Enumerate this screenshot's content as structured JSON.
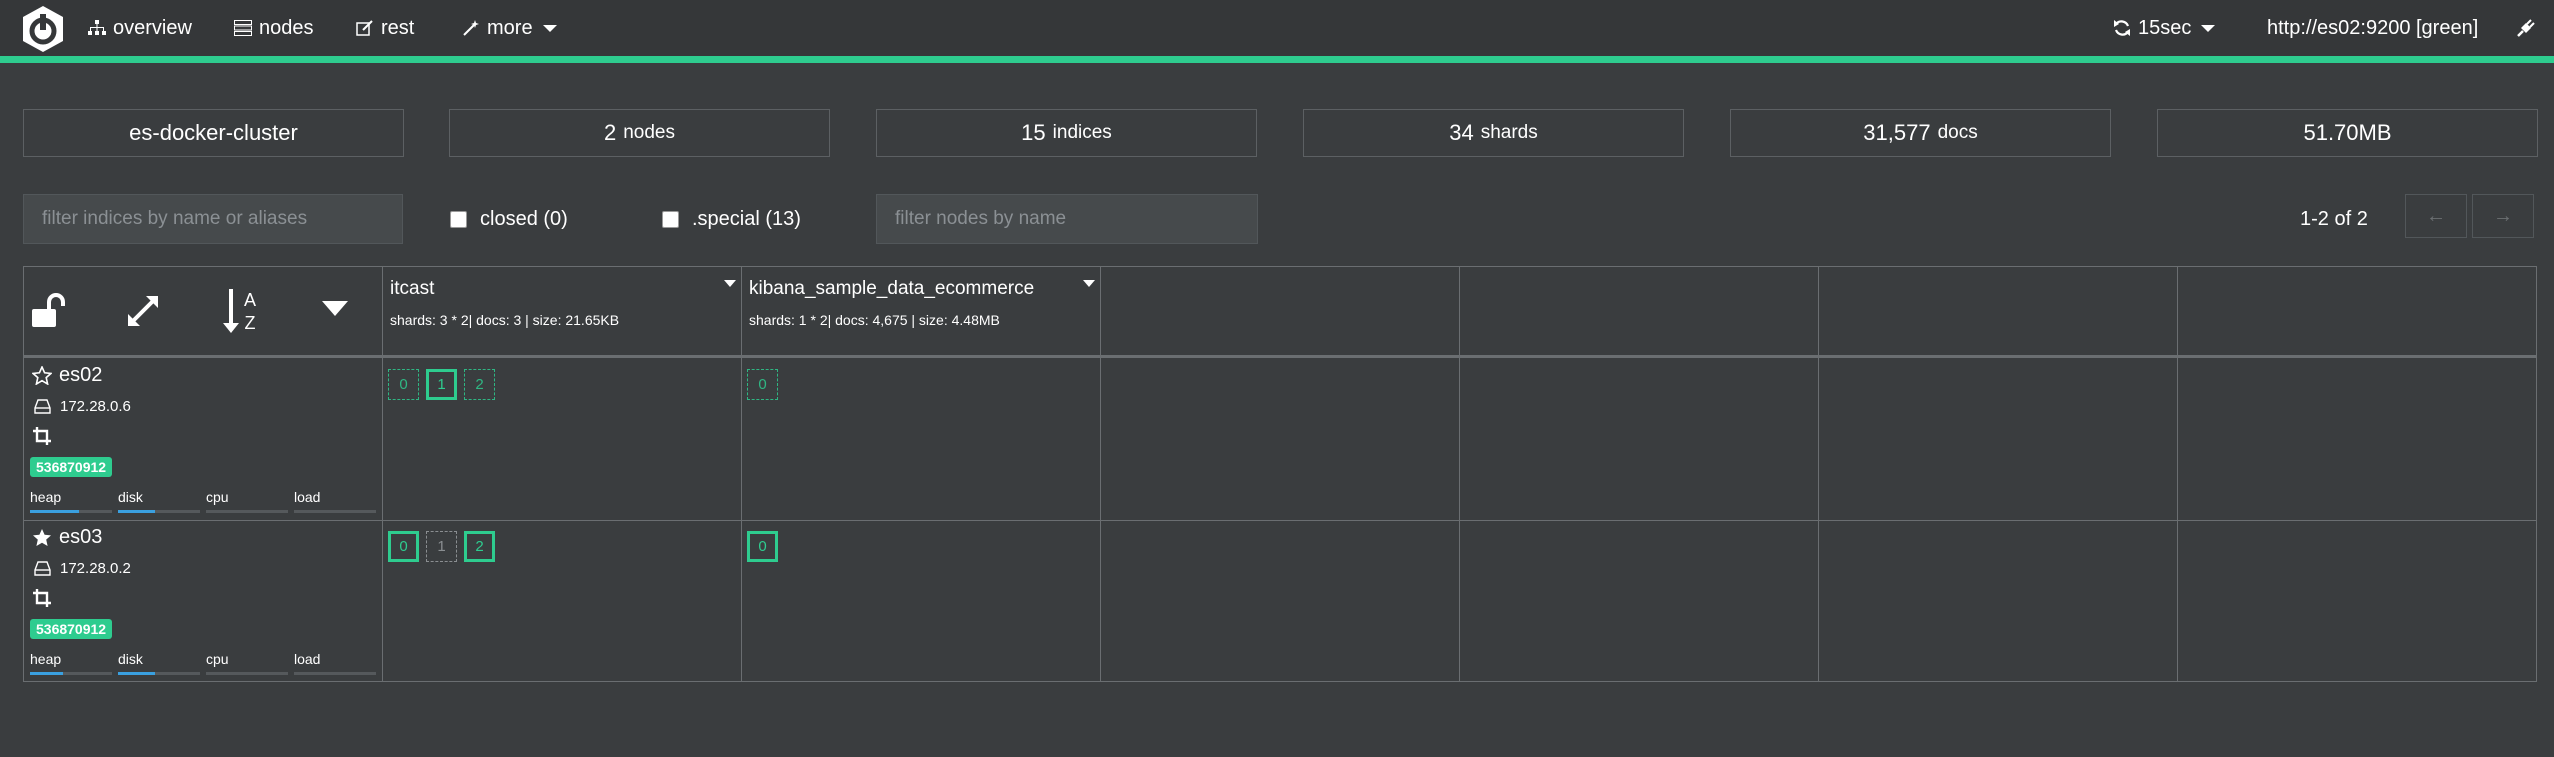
{
  "nav": {
    "overview": "overview",
    "nodes": "nodes",
    "rest": "rest",
    "more": "more",
    "refresh": "15sec",
    "host": "http://es02:9200 [green]"
  },
  "stats": {
    "cluster": "es-docker-cluster",
    "nodes_count": "2",
    "nodes_label": "nodes",
    "indices_count": "15",
    "indices_label": "indices",
    "shards_count": "34",
    "shards_label": "shards",
    "docs_count": "31,577",
    "docs_label": "docs",
    "size": "51.70MB"
  },
  "filters": {
    "indices_placeholder": "filter indices by name or aliases",
    "closed": "closed (0)",
    "special": ".special (13)",
    "nodes_placeholder": "filter nodes by name",
    "pager": "1-2 of 2",
    "prev": "←",
    "next": "→"
  },
  "indices": [
    {
      "name": "itcast",
      "info": "shards: 3 * 2| docs: 3 | size: 21.65KB"
    },
    {
      "name": "kibana_sample_data_ecommerce",
      "info": "shards: 1 * 2| docs: 4,675 | size: 4.48MB"
    }
  ],
  "nodes": [
    {
      "name": "es02",
      "ip": "172.28.0.6",
      "badge": "536870912",
      "labels": {
        "heap": "heap",
        "disk": "disk",
        "cpu": "cpu",
        "load": "load"
      },
      "heap": 0.6,
      "disk": 0.45,
      "cpu": 0,
      "load": 0,
      "itcast_shards": [
        "0",
        "1",
        "2"
      ],
      "kibana_shards": [
        "0"
      ]
    },
    {
      "name": "es03",
      "ip": "172.28.0.2",
      "badge": "536870912",
      "labels": {
        "heap": "heap",
        "disk": "disk",
        "cpu": "cpu",
        "load": "load"
      },
      "heap": 0.4,
      "disk": 0.45,
      "cpu": 0,
      "load": 0,
      "itcast_shards": [
        "0",
        "1",
        "2"
      ],
      "kibana_shards": [
        "0"
      ]
    }
  ],
  "colors": {
    "accent": "#2ecc8f",
    "background": "#3a3d3f",
    "navbar": "#353739",
    "metric": "#3aa0e0"
  }
}
